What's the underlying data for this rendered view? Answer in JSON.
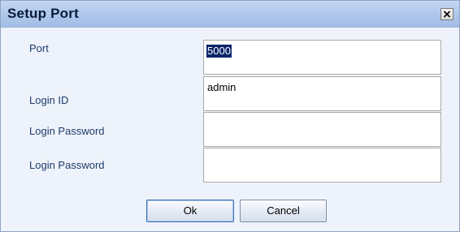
{
  "window": {
    "title": "Setup Port",
    "close_glyph": "close-icon"
  },
  "form": {
    "port": {
      "label": "Port",
      "value": "5000"
    },
    "login_id": {
      "label": "Login ID",
      "value": "admin"
    },
    "password": {
      "label": "Login Password",
      "value": ""
    },
    "password_confirm": {
      "label": "Login Password",
      "value": ""
    }
  },
  "buttons": {
    "ok_label": "Ok",
    "cancel_label": "Cancel"
  },
  "colors": {
    "titlebar": "#aec6ea",
    "dialog_bg": "#eef3fb",
    "label_text": "#1f3b6b",
    "selection": "#0a246a"
  }
}
